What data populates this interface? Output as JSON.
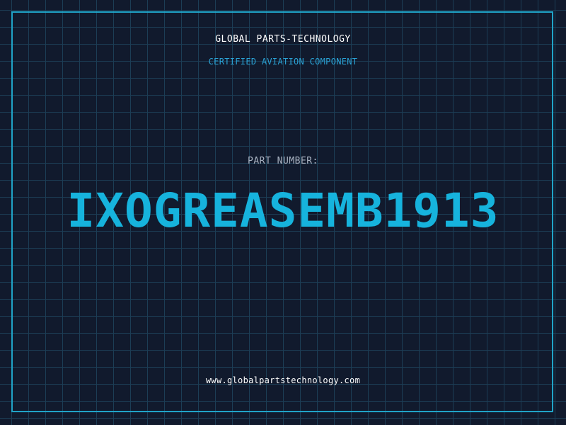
{
  "header": {
    "company": "GLOBAL PARTS-TECHNOLOGY",
    "subtitle": "CERTIFIED AVIATION COMPONENT"
  },
  "part": {
    "label": "PART NUMBER:",
    "number": "IXOGREASEMB1913"
  },
  "footer": {
    "url": "www.globalpartstechnology.com"
  },
  "colors": {
    "background": "#111a2d",
    "grid": "#1c3d55",
    "accent": "#16b3dd",
    "frame": "#20a3c7"
  }
}
